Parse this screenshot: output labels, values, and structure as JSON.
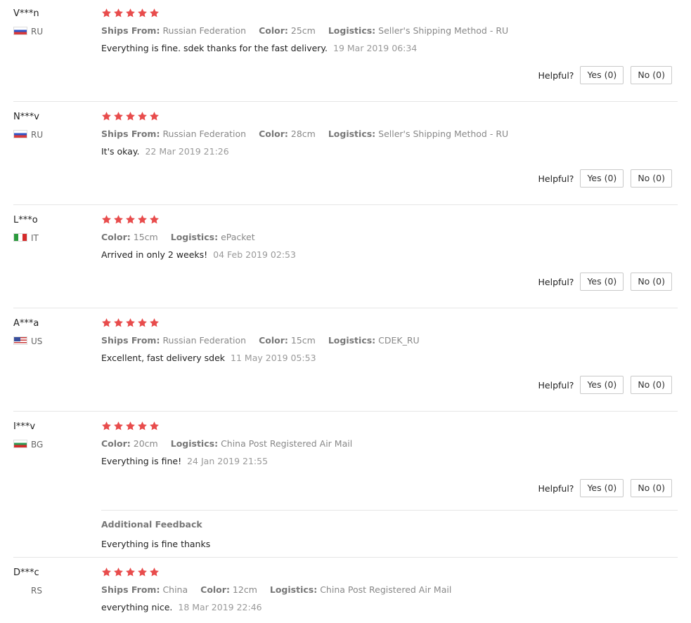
{
  "helpful_label": "Helpful?",
  "colors": {
    "star": "#e84c4c",
    "divider": "#e6e6e6",
    "label_gray": "#888888"
  },
  "reviews": [
    {
      "user": "V***n",
      "country": "RU",
      "flag": "ru",
      "stars": 5,
      "meta": [
        {
          "label": "Ships From:",
          "value": "Russian Federation"
        },
        {
          "label": "Color:",
          "value": "25cm"
        },
        {
          "label": "Logistics:",
          "value": "Seller's Shipping Method - RU"
        }
      ],
      "comment": "Everything is fine. sdek thanks for the fast delivery.",
      "date": "19 Mar 2019 06:34",
      "yes": "Yes (0)",
      "no": "No (0)"
    },
    {
      "user": "N***v",
      "country": "RU",
      "flag": "ru",
      "stars": 5,
      "meta": [
        {
          "label": "Ships From:",
          "value": "Russian Federation"
        },
        {
          "label": "Color:",
          "value": "28cm"
        },
        {
          "label": "Logistics:",
          "value": "Seller's Shipping Method - RU"
        }
      ],
      "comment": "It's okay.",
      "date": "22 Mar 2019 21:26",
      "yes": "Yes (0)",
      "no": "No (0)"
    },
    {
      "user": "L***o",
      "country": "IT",
      "flag": "it",
      "stars": 5,
      "meta": [
        {
          "label": "Color:",
          "value": "15cm"
        },
        {
          "label": "Logistics:",
          "value": "ePacket"
        }
      ],
      "comment": "Arrived in only 2 weeks!",
      "date": "04 Feb 2019 02:53",
      "yes": "Yes (0)",
      "no": "No (0)"
    },
    {
      "user": "A***a",
      "country": "US",
      "flag": "us",
      "stars": 5,
      "meta": [
        {
          "label": "Ships From:",
          "value": "Russian Federation"
        },
        {
          "label": "Color:",
          "value": "15cm"
        },
        {
          "label": "Logistics:",
          "value": "CDEK_RU"
        }
      ],
      "comment": "Excellent, fast delivery sdek",
      "date": "11 May 2019 05:53",
      "yes": "Yes (0)",
      "no": "No (0)"
    },
    {
      "user": "I***v",
      "country": "BG",
      "flag": "bg",
      "stars": 5,
      "meta": [
        {
          "label": "Color:",
          "value": "20cm"
        },
        {
          "label": "Logistics:",
          "value": "China Post Registered Air Mail"
        }
      ],
      "comment": "Everything is fine!",
      "date": "24 Jan 2019 21:55",
      "yes": "Yes (0)",
      "no": "No (0)",
      "additional": {
        "title": "Additional Feedback",
        "text": "Everything is fine thanks"
      }
    },
    {
      "user": "D***c",
      "country": "RS",
      "flag": "none",
      "stars": 5,
      "meta": [
        {
          "label": "Ships From:",
          "value": "China"
        },
        {
          "label": "Color:",
          "value": "12cm"
        },
        {
          "label": "Logistics:",
          "value": "China Post Registered Air Mail"
        }
      ],
      "comment": "everything nice.",
      "date": "18 Mar 2019 22:46"
    }
  ]
}
